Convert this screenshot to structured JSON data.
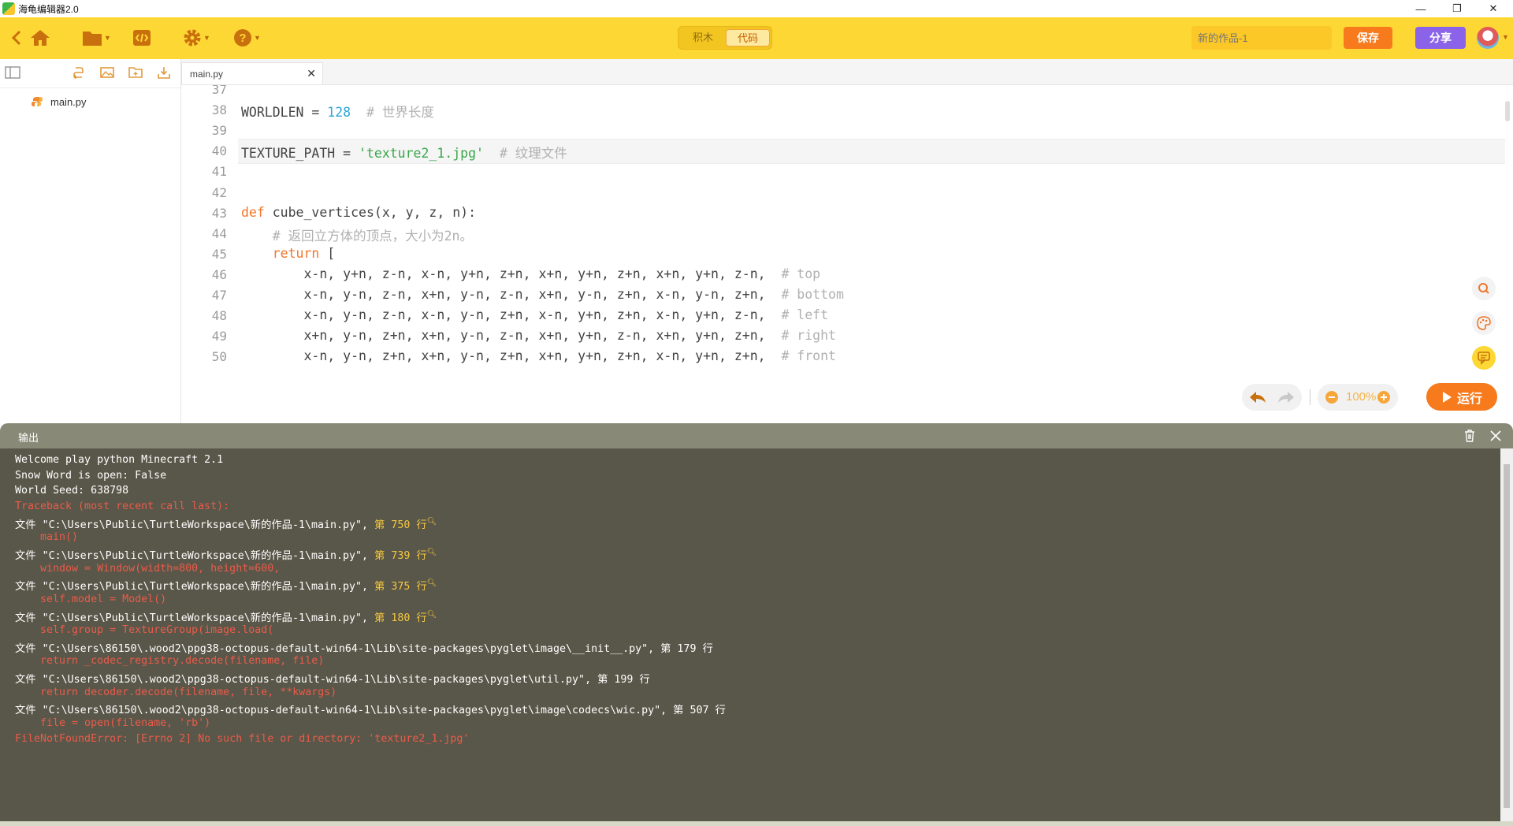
{
  "window": {
    "title": "海龟编辑器2.0",
    "controls": [
      "—",
      "❐",
      "✕"
    ]
  },
  "toolbar": {
    "icons": [
      "back-icon",
      "home-icon",
      "folder-icon",
      "code-icon",
      "gear-icon",
      "help-icon"
    ],
    "mode_tabs": [
      {
        "label": "积木",
        "active": false
      },
      {
        "label": "代码",
        "active": true
      }
    ],
    "project_name_placeholder": "新的作品-1",
    "save_label": "保存",
    "share_label": "分享",
    "colors": {
      "toolbar": "#fdd733",
      "save": "#f77a1c",
      "share": "#8b63e8"
    }
  },
  "sidebar": {
    "tools": [
      "layout-icon",
      "python-file-icon",
      "image-icon",
      "folder-add-icon",
      "download-icon"
    ],
    "files": [
      {
        "name": "main.py",
        "icon": "python-icon"
      }
    ]
  },
  "editor": {
    "tab": {
      "filename": "main.py",
      "close": "✕"
    },
    "lines": [
      {
        "n": "37",
        "html": ""
      },
      {
        "n": "38",
        "html": "WORLDLEN = <span class=\"num\">128</span>  <span class=\"cm\"># 世界长度</span>"
      },
      {
        "n": "39",
        "html": ""
      },
      {
        "n": "40",
        "html": "TEXTURE_PATH = <span class=\"str\">'texture2_1.jpg'</span>  <span class=\"cm\"># 纹理文件</span>",
        "active": true
      },
      {
        "n": "41",
        "html": ""
      },
      {
        "n": "42",
        "html": ""
      },
      {
        "n": "43",
        "html": "<span class=\"kw\">def</span> cube_vertices(x, y, z, n):"
      },
      {
        "n": "44",
        "html": "    <span class=\"cm\"># 返回立方体的顶点，大小为2n。</span>"
      },
      {
        "n": "45",
        "html": "    <span class=\"kw\">return</span> ["
      },
      {
        "n": "46",
        "html": "        x-n, y+n, z-n, x-n, y+n, z+n, x+n, y+n, z+n, x+n, y+n, z-n,  <span class=\"cm\"># top</span>"
      },
      {
        "n": "47",
        "html": "        x-n, y-n, z-n, x+n, y-n, z-n, x+n, y-n, z+n, x-n, y-n, z+n,  <span class=\"cm\"># bottom</span>"
      },
      {
        "n": "48",
        "html": "        x-n, y-n, z-n, x-n, y-n, z+n, x-n, y+n, z+n, x-n, y+n, z-n,  <span class=\"cm\"># left</span>"
      },
      {
        "n": "49",
        "html": "        x+n, y-n, z+n, x+n, y-n, z-n, x+n, y+n, z-n, x+n, y+n, z+n,  <span class=\"cm\"># right</span>"
      },
      {
        "n": "50",
        "html": "        x-n, y-n, z+n, x+n, y-n, z+n, x+n, y+n, z+n, x-n, y+n, z+n,  <span class=\"cm\"># front</span>"
      }
    ],
    "zoom": "100%",
    "run_label": "运行",
    "side_tools": [
      "search-icon",
      "palette-icon",
      "comment-icon"
    ]
  },
  "output": {
    "title": "输出",
    "lines": [
      {
        "text": "Welcome play python Minecraft 2.1",
        "c": "w"
      },
      {
        "text": "Snow Word is open: False",
        "c": "w"
      },
      {
        "text": "World Seed: 638798",
        "c": "w"
      },
      {
        "text": "Traceback (most recent call last):",
        "c": "r"
      },
      {
        "html": "<span class=\"w\">文件 \"C:\\Users\\Public\\TurtleWorkspace\\新的作品-1\\main.py\", </span><span class=\"y\">第 750 行</span><span class=\"y\" style=\"font-size:10px;vertical-align:super\">🔍︎</span>"
      },
      {
        "text": "    main()",
        "c": "r"
      },
      {
        "html": "<span class=\"w\">文件 \"C:\\Users\\Public\\TurtleWorkspace\\新的作品-1\\main.py\", </span><span class=\"y\">第 739 行</span><span class=\"y\" style=\"font-size:10px;vertical-align:super\">🔍︎</span>"
      },
      {
        "text": "    window = Window(width=800, height=600,",
        "c": "r"
      },
      {
        "html": "<span class=\"w\">文件 \"C:\\Users\\Public\\TurtleWorkspace\\新的作品-1\\main.py\", </span><span class=\"y\">第 375 行</span><span class=\"y\" style=\"font-size:10px;vertical-align:super\">🔍︎</span>"
      },
      {
        "text": "    self.model = Model()",
        "c": "r"
      },
      {
        "html": "<span class=\"w\">文件 \"C:\\Users\\Public\\TurtleWorkspace\\新的作品-1\\main.py\", </span><span class=\"y\">第 180 行</span><span class=\"y\" style=\"font-size:10px;vertical-align:super\">🔍︎</span>"
      },
      {
        "text": "    self.group = TextureGroup(image.load(",
        "c": "r"
      },
      {
        "text": "文件 \"C:\\Users\\86150\\.wood2\\ppg38-octopus-default-win64-1\\Lib\\site-packages\\pyglet\\image\\__init__.py\", 第 179 行",
        "c": "w"
      },
      {
        "text": "    return _codec_registry.decode(filename, file)",
        "c": "r"
      },
      {
        "text": "文件 \"C:\\Users\\86150\\.wood2\\ppg38-octopus-default-win64-1\\Lib\\site-packages\\pyglet\\util.py\", 第 199 行",
        "c": "w"
      },
      {
        "text": "    return decoder.decode(filename, file, **kwargs)",
        "c": "r"
      },
      {
        "text": "文件 \"C:\\Users\\86150\\.wood2\\ppg38-octopus-default-win64-1\\Lib\\site-packages\\pyglet\\image\\codecs\\wic.py\", 第 507 行",
        "c": "w"
      },
      {
        "text": "    file = open(filename, 'rb')",
        "c": "r"
      },
      {
        "text": "FileNotFoundError: [Errno 2] No such file or directory: 'texture2_1.jpg'",
        "c": "r"
      }
    ]
  }
}
